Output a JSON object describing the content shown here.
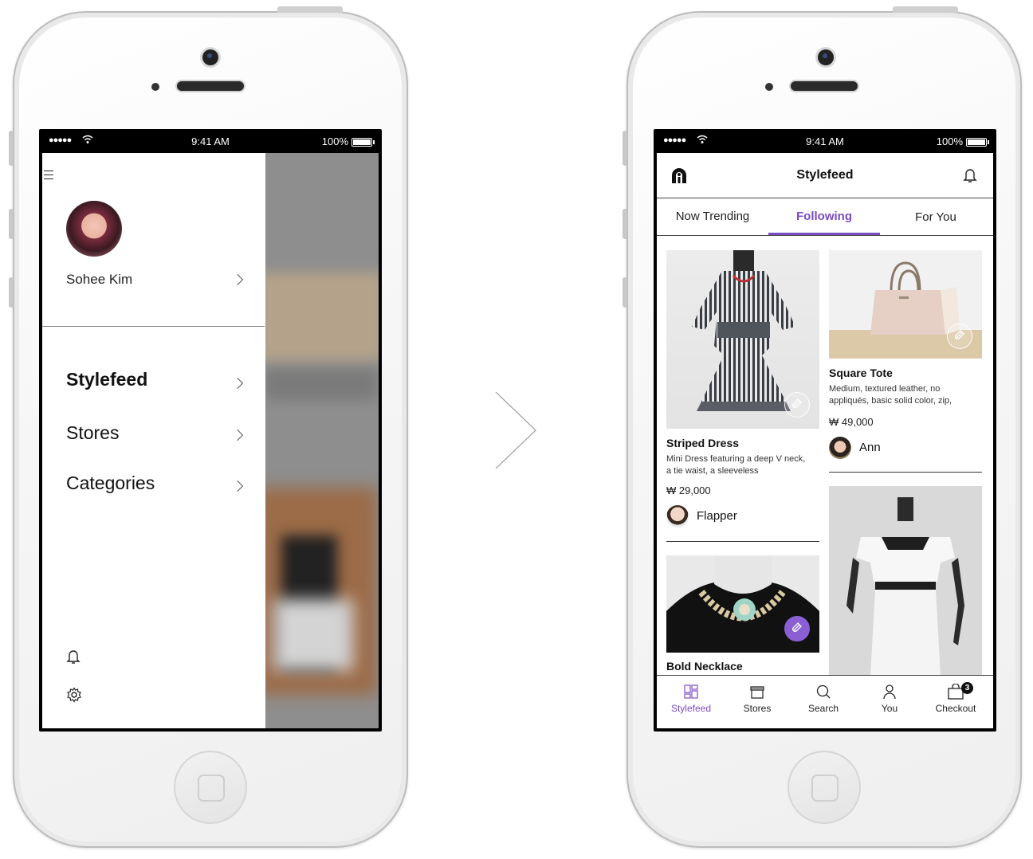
{
  "status_bar": {
    "signal": "●●●●●",
    "time": "9:41 AM",
    "battery": "100%"
  },
  "drawer": {
    "profile": {
      "name": "Sohee Kim"
    },
    "nav_items": [
      {
        "label": "Stylefeed"
      },
      {
        "label": "Stores"
      },
      {
        "label": "Categories"
      }
    ],
    "footer_icons": [
      "bell-icon",
      "gear-icon"
    ]
  },
  "feed": {
    "title": "Stylefeed",
    "tabs": [
      {
        "label": "Now Trending",
        "active": false
      },
      {
        "label": "Following",
        "active": true
      },
      {
        "label": "For You",
        "active": false
      }
    ],
    "cards": [
      {
        "title": "Striped Dress",
        "description": "Mini Dress featuring a deep V neck, a tie waist, a sleeveless",
        "price": "₩ 29,000",
        "user": "Flapper"
      },
      {
        "title": "Square Tote",
        "description": "Medium, textured leather, no appliqués, basic solid color, zip,",
        "price": "₩ 49,000",
        "user": "Ann"
      },
      {
        "title": "Bold Necklace"
      }
    ],
    "bottom_nav": [
      {
        "label": "Stylefeed",
        "active": true
      },
      {
        "label": "Stores",
        "active": false
      },
      {
        "label": "Search",
        "active": false
      },
      {
        "label": "You",
        "active": false
      },
      {
        "label": "Checkout",
        "active": false,
        "badge": "3"
      }
    ]
  },
  "colors": {
    "accent": "#7a4cc3",
    "status_bar_bg": "#000000"
  }
}
